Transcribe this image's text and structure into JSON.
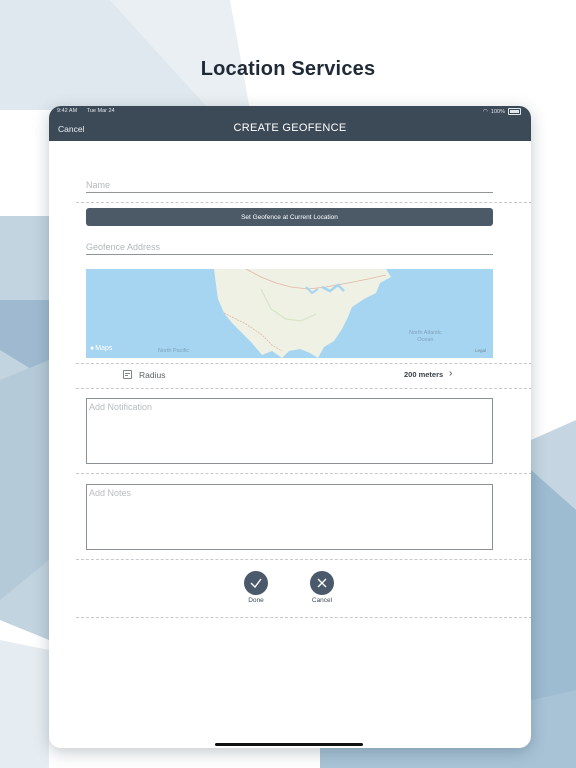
{
  "promo": {
    "title": "Location Services"
  },
  "status_bar": {
    "time": "9:42 AM",
    "date": "Tue Mar 24",
    "battery": "100%"
  },
  "navbar": {
    "cancel_label": "Cancel",
    "title": "CREATE GEOFENCE"
  },
  "form": {
    "name_placeholder": "Name",
    "set_location_button": "Set Geofence at Current Location",
    "address_placeholder": "Geofence Address",
    "map": {
      "attribution": "Maps",
      "label_pacific": "North Pacific",
      "label_atlantic_1": "North Atlantic",
      "label_atlantic_2": "Ocean",
      "legal": "Legal"
    },
    "radius": {
      "label": "Radius",
      "value": "200 meters"
    },
    "notification_placeholder": "Add Notification",
    "notes_placeholder": "Add Notes"
  },
  "actions": {
    "done_label": "Done",
    "cancel_label": "Cancel"
  },
  "colors": {
    "navbar": "#3c4a57",
    "button": "#4c5a67",
    "action_circle": "#4a5a6c",
    "map_water": "#a6d5f1",
    "map_land": "#eef1e4"
  },
  "icons": [
    "wifi-icon",
    "battery-icon",
    "radius-icon",
    "chevron-right-icon",
    "checkmark-icon",
    "close-icon",
    "apple-icon"
  ]
}
